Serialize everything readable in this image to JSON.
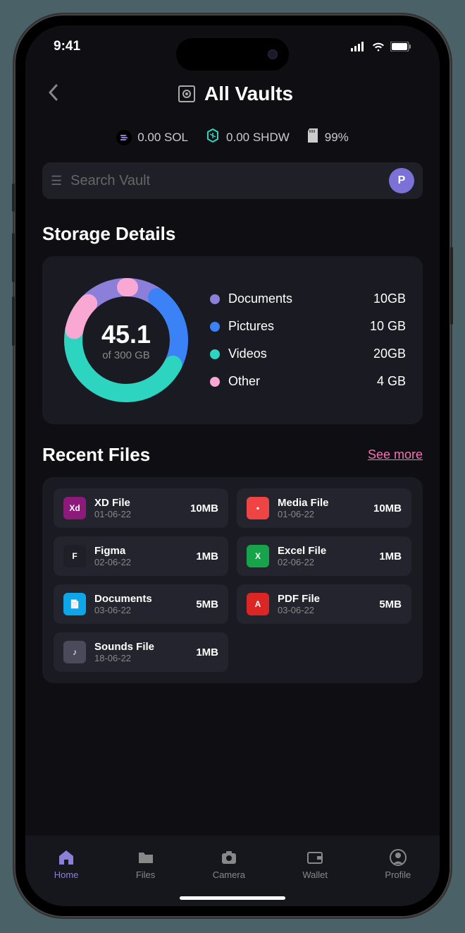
{
  "status": {
    "time": "9:41"
  },
  "header": {
    "title": "All Vaults"
  },
  "stats": {
    "sol": "0.00 SOL",
    "shdw": "0.00 SHDW",
    "storage_pct": "99%"
  },
  "search": {
    "placeholder": "Search Vault",
    "avatar_letter": "P"
  },
  "storage": {
    "section_title": "Storage Details",
    "used": "45.1",
    "total_label": "of 300 GB",
    "legend": [
      {
        "name": "Documents",
        "value": "10GB",
        "color": "#8b7fd9"
      },
      {
        "name": "Pictures",
        "value": "10 GB",
        "color": "#3b82f6"
      },
      {
        "name": "Videos",
        "value": "20GB",
        "color": "#2dd4bf"
      },
      {
        "name": "Other",
        "value": "4 GB",
        "color": "#f9a8d4"
      }
    ]
  },
  "chart_data": {
    "type": "pie",
    "title": "Storage Details",
    "total": 300,
    "used": 45.1,
    "unit": "GB",
    "series": [
      {
        "name": "Documents",
        "value": 10,
        "color": "#8b7fd9"
      },
      {
        "name": "Pictures",
        "value": 10,
        "color": "#3b82f6"
      },
      {
        "name": "Videos",
        "value": 20,
        "color": "#2dd4bf"
      },
      {
        "name": "Other",
        "value": 4,
        "color": "#f9a8d4"
      }
    ]
  },
  "recent": {
    "title": "Recent Files",
    "see_more": "See more",
    "files": [
      {
        "name": "XD File",
        "date": "01-06-22",
        "size": "10MB",
        "icon_bg": "#8b1a7a",
        "icon_text": "Xd"
      },
      {
        "name": "Media File",
        "date": "01-06-22",
        "size": "10MB",
        "icon_bg": "#ef4444",
        "icon_text": "•"
      },
      {
        "name": "Figma",
        "date": "02-06-22",
        "size": "1MB",
        "icon_bg": "#1f1f28",
        "icon_text": "F"
      },
      {
        "name": "Excel File",
        "date": "02-06-22",
        "size": "1MB",
        "icon_bg": "#16a34a",
        "icon_text": "X"
      },
      {
        "name": "Documents",
        "date": "03-06-22",
        "size": "5MB",
        "icon_bg": "#0ea5e9",
        "icon_text": "📄"
      },
      {
        "name": "PDF File",
        "date": "03-06-22",
        "size": "5MB",
        "icon_bg": "#dc2626",
        "icon_text": "A"
      },
      {
        "name": "Sounds File",
        "date": "18-06-22",
        "size": "1MB",
        "icon_bg": "#4a4a5a",
        "icon_text": "♪"
      }
    ]
  },
  "nav": {
    "items": [
      {
        "label": "Home",
        "active": true
      },
      {
        "label": "Files",
        "active": false
      },
      {
        "label": "Camera",
        "active": false
      },
      {
        "label": "Wallet",
        "active": false
      },
      {
        "label": "Profile",
        "active": false
      }
    ]
  }
}
